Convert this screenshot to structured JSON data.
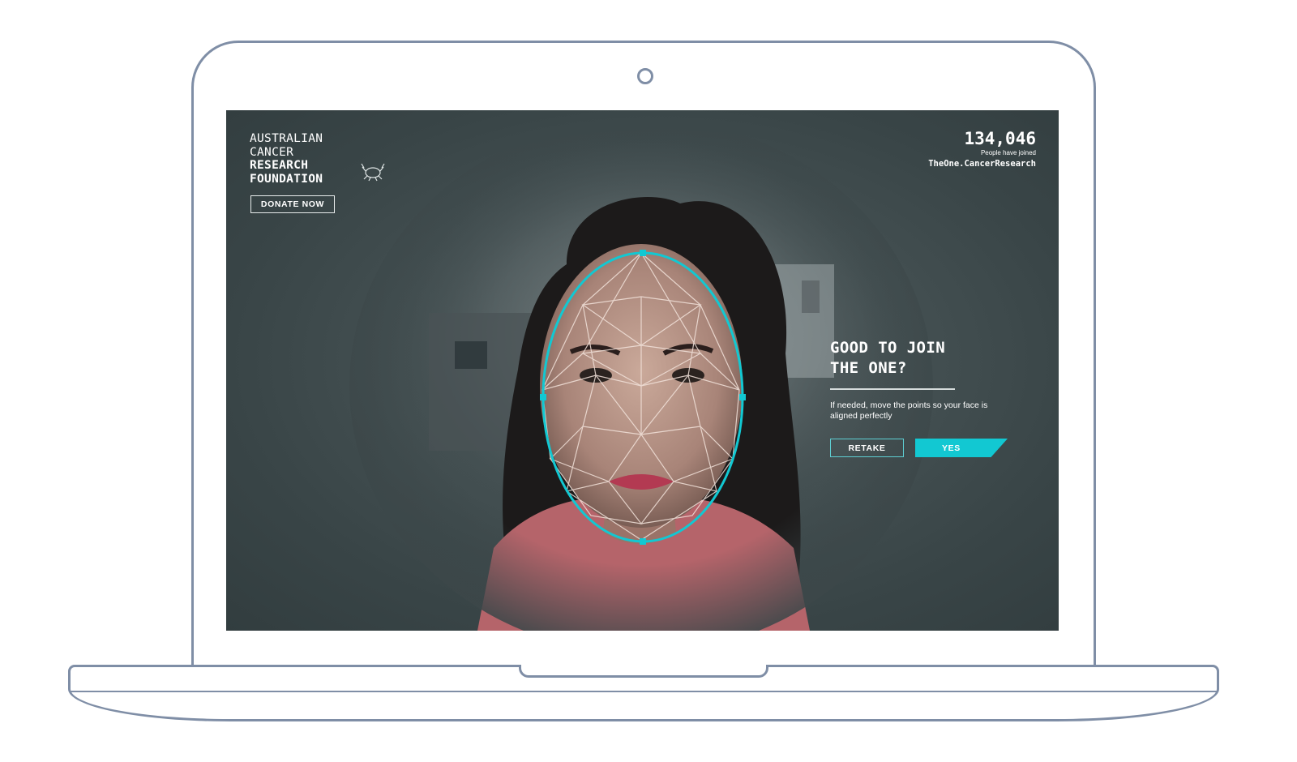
{
  "brand": {
    "lines": [
      "AUSTRALIAN",
      "CANCER",
      "RESEARCH",
      "FOUNDATION"
    ],
    "logo_icon": "crab-icon",
    "donate_label": "DONATE NOW"
  },
  "counter": {
    "number": "134,046",
    "caption": "People have joined",
    "site": "TheOne.CancerResearch"
  },
  "prompt": {
    "title_line1": "GOOD TO JOIN",
    "title_line2": "THE ONE?",
    "help": "If needed, move the points so your face is aligned perfectly",
    "retake_label": "RETAKE",
    "yes_label": "YES"
  },
  "colors": {
    "accent": "#12c8d2",
    "screen_bg": "#3c4749",
    "frame": "#7f8ea6"
  }
}
